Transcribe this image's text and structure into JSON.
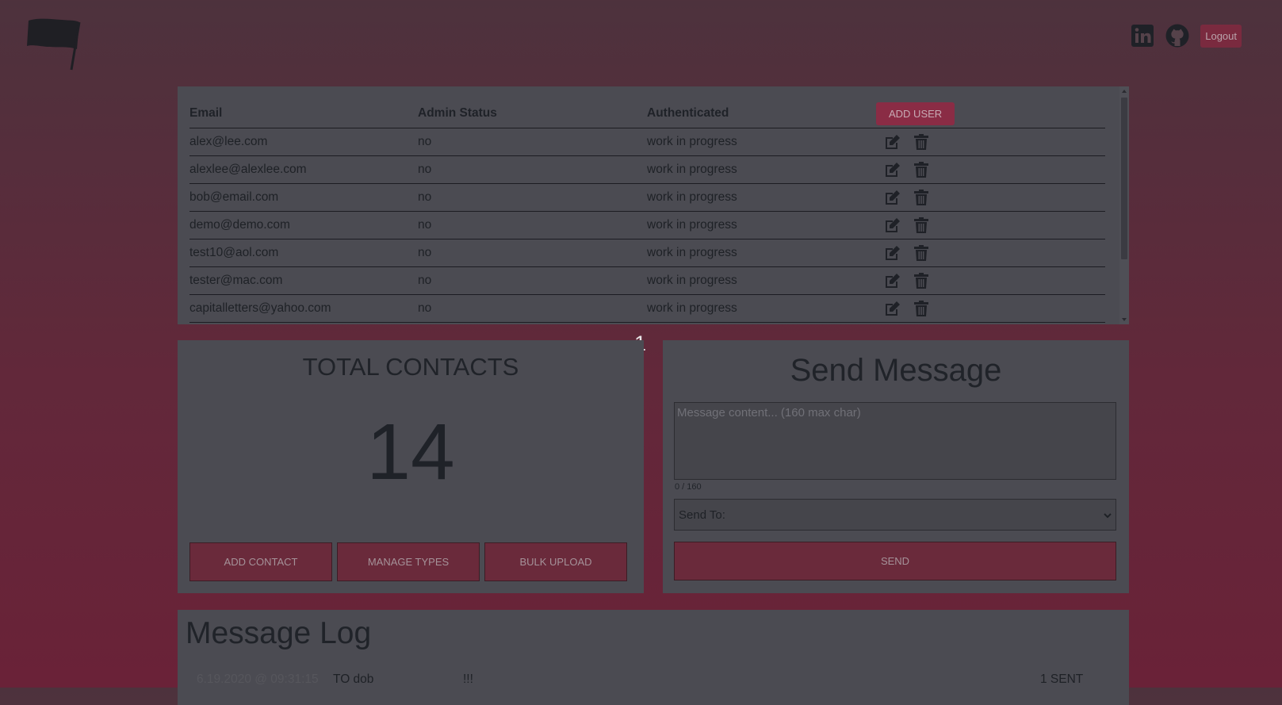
{
  "header": {
    "logout_label": "Logout",
    "linkedin_icon": "linkedin-icon",
    "github_icon": "github-icon",
    "logo_icon": "flag-icon"
  },
  "users": {
    "columns": [
      "Email",
      "Admin Status",
      "Authenticated"
    ],
    "add_user_label": "ADD USER",
    "rows": [
      {
        "email": "alex@lee.com",
        "admin": "no",
        "auth": "work in progress"
      },
      {
        "email": "alexlee@alexlee.com",
        "admin": "no",
        "auth": "work in progress"
      },
      {
        "email": "bob@email.com",
        "admin": "no",
        "auth": "work in progress"
      },
      {
        "email": "demo@demo.com",
        "admin": "no",
        "auth": "work in progress"
      },
      {
        "email": "test10@aol.com",
        "admin": "no",
        "auth": "work in progress"
      },
      {
        "email": "tester@mac.com",
        "admin": "no",
        "auth": "work in progress"
      },
      {
        "email": "capitalletters@yahoo.com",
        "admin": "no",
        "auth": "work in progress"
      }
    ]
  },
  "badge": "1",
  "contacts": {
    "title": "TOTAL CONTACTS",
    "count": "14",
    "buttons": [
      "ADD CONTACT",
      "MANAGE TYPES",
      "BULK UPLOAD"
    ]
  },
  "send_message": {
    "title": "Send Message",
    "placeholder": "Message content... (160 max char)",
    "char_count": "0 / 160",
    "send_to_label": "Send To:",
    "send_label": "SEND"
  },
  "message_log": {
    "title": "Message Log",
    "entries": [
      {
        "timestamp": "6.19.2020 @ 09:31:15",
        "to": "TO dob",
        "message": "!!!",
        "status": "1 SENT"
      }
    ]
  },
  "colors": {
    "background_top": "#4d323d",
    "background_bottom": "#6a2238",
    "panel": "#4b4b52",
    "accent": "#8a2c45"
  }
}
